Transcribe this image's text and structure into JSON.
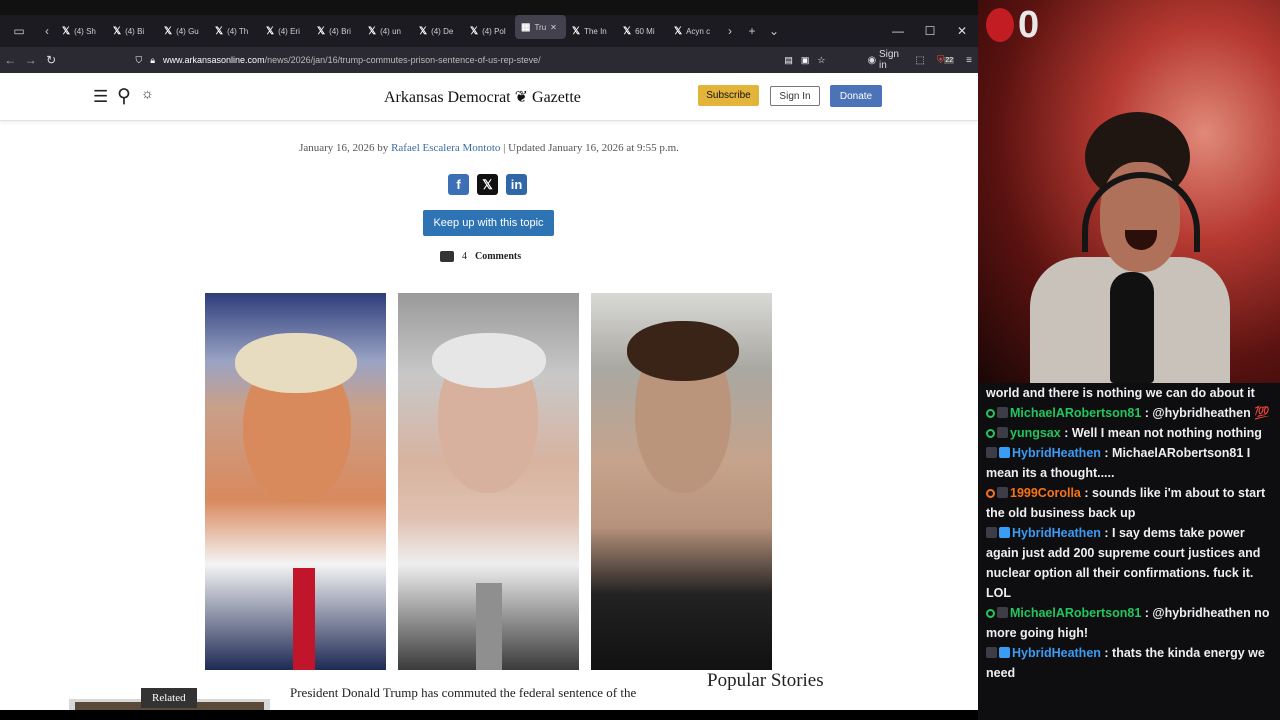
{
  "tabs": [
    {
      "label": "(4) Sh"
    },
    {
      "label": "(4) Bi"
    },
    {
      "label": "(4) Gu"
    },
    {
      "label": "(4) Th"
    },
    {
      "label": "(4) Eri"
    },
    {
      "label": "(4) Bri"
    },
    {
      "label": "(4) un"
    },
    {
      "label": "(4) De"
    },
    {
      "label": "(4) Pol"
    },
    {
      "label": "Tru",
      "active": true
    },
    {
      "label": "The In"
    },
    {
      "label": "60 Mi"
    },
    {
      "label": "Acyn c"
    }
  ],
  "nav": {
    "url_domain": "www.arkansasonline.com",
    "url_path": "/news/2026/jan/16/trump-commutes-prison-sentence-of-us-rep-steve/",
    "sign_in": "Sign in",
    "ext_badge": "22"
  },
  "site": {
    "logo": "Arkansas Democrat ❦ Gazette",
    "subscribe": "Subscribe",
    "signin": "Sign In",
    "donate": "Donate"
  },
  "article": {
    "date": "January 16, 2026 by",
    "author": "Rafael Escalera Montoto",
    "updated": "| Updated January 16, 2026 at 9:55 p.m.",
    "keep_up": "Keep up with this topic",
    "comments_count": "4",
    "comments_label": "Comments",
    "related": "Related",
    "lede": "President Donald Trump has commuted the federal sentence of the",
    "popular": "Popular Stories"
  },
  "stream": {
    "score": "0",
    "chat": [
      {
        "user": "",
        "text": "world and there is nothing we can do about it",
        "color": "#efeff1",
        "icon": "none"
      },
      {
        "user": "MichaelARobertson81",
        "text": ": @hybridheathen 💯",
        "color": "#22c55e",
        "icon": "user"
      },
      {
        "user": "yungsax",
        "text": ": Well I mean not nothing nothing",
        "color": "#22c55e",
        "icon": "user"
      },
      {
        "user": "HybridHeathen",
        "text": ": MichaelARobertson81 I mean its a thought.....",
        "color": "#3a9cf5",
        "icon": "badge"
      },
      {
        "user": "1999Corolla",
        "text": ": sounds like i'm about to start the old business back up",
        "color": "#f97316",
        "icon": "user"
      },
      {
        "user": "HybridHeathen",
        "text": ": I say dems take power again just add 200 supreme court justices and nuclear option all their confirmations. fuck it. LOL",
        "color": "#3a9cf5",
        "icon": "badge"
      },
      {
        "user": "MichaelARobertson81",
        "text": ": @hybridheathen no more going high!",
        "color": "#22c55e",
        "icon": "user"
      },
      {
        "user": "HybridHeathen",
        "text": ": thats the kinda energy we need",
        "color": "#3a9cf5",
        "icon": "badge"
      }
    ]
  }
}
